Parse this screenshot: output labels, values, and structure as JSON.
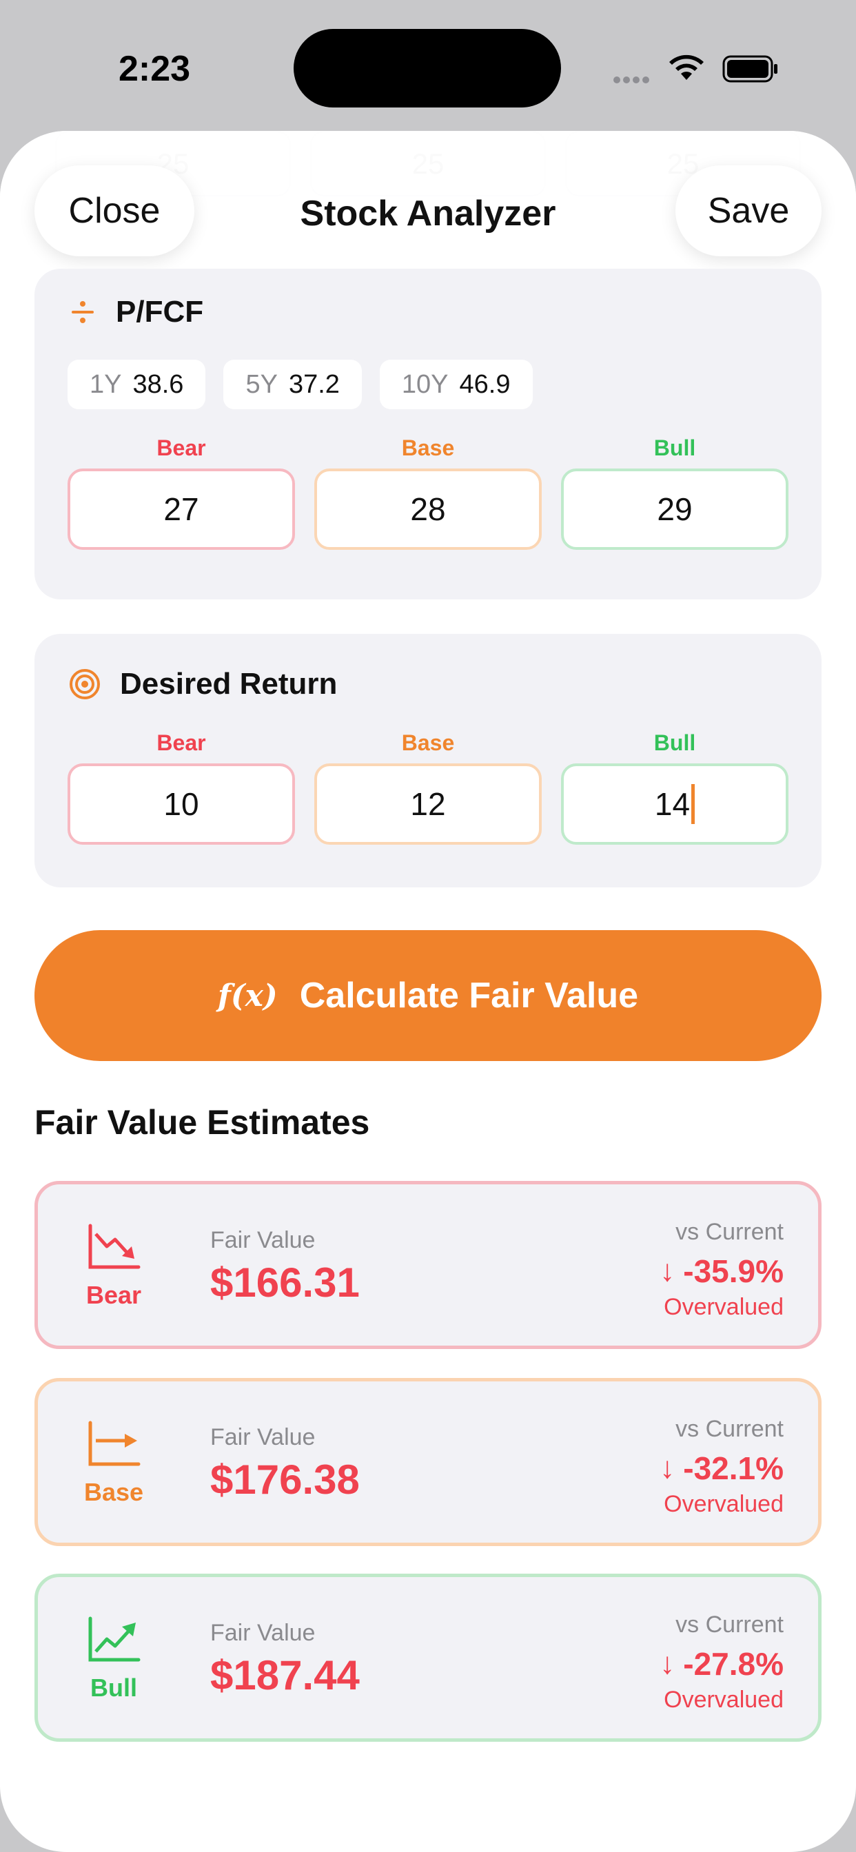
{
  "status": {
    "time": "2:23"
  },
  "nav": {
    "close": "Close",
    "title": "Stock Analyzer",
    "save": "Save"
  },
  "ghost_values": [
    "25",
    "25",
    "25"
  ],
  "pfcf": {
    "title": "P/FCF",
    "icon": "divide-icon",
    "history": [
      {
        "label": "1Y",
        "value": "38.6"
      },
      {
        "label": "5Y",
        "value": "37.2"
      },
      {
        "label": "10Y",
        "value": "46.9"
      }
    ],
    "scenarios": {
      "bear": "27",
      "base": "28",
      "bull": "29"
    }
  },
  "desired_return": {
    "title": "Desired Return",
    "icon": "target-icon",
    "scenarios": {
      "bear": "10",
      "base": "12",
      "bull": "14"
    }
  },
  "scenario_labels": {
    "bear": "Bear",
    "base": "Base",
    "bull": "Bull"
  },
  "calculate": {
    "icon_text": "f(x)",
    "label": "Calculate Fair Value"
  },
  "estimates": {
    "title": "Fair Value Estimates",
    "fv_label": "Fair Value",
    "vs_label": "vs Current",
    "items": [
      {
        "name": "Bear",
        "value": "$166.31",
        "delta": "-35.9%",
        "verdict": "Overvalued"
      },
      {
        "name": "Base",
        "value": "$176.38",
        "delta": "-32.1%",
        "verdict": "Overvalued"
      },
      {
        "name": "Bull",
        "value": "$187.44",
        "delta": "-27.8%",
        "verdict": "Overvalued"
      }
    ]
  },
  "colors": {
    "bear": "#f0424f",
    "base": "#f0852d",
    "bull": "#33c159",
    "accent": "#f0822b"
  }
}
